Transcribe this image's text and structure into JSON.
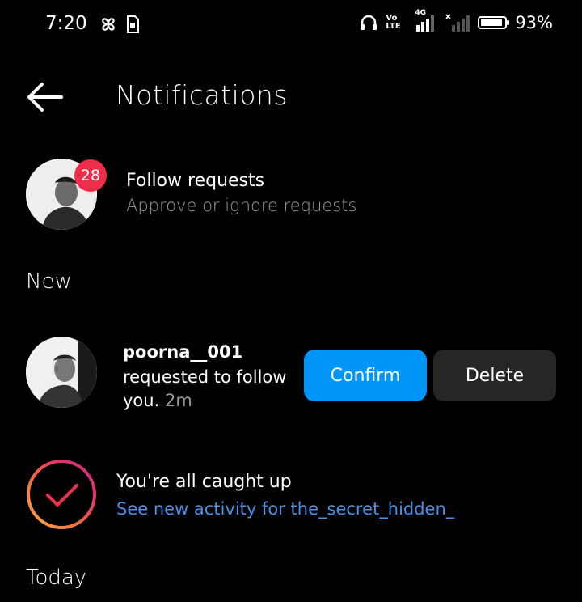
{
  "status_bar": {
    "time": "7:20",
    "volte_label": "Vo LTE",
    "network": "4G",
    "battery_percent": "93%",
    "battery_level": 0.93,
    "icons": [
      "pinwheel-icon",
      "sim-card-icon",
      "headphones-icon",
      "signal-icon",
      "signal-off-icon",
      "battery-icon"
    ]
  },
  "header": {
    "back_icon": "arrow-left-icon",
    "title": "Notifications"
  },
  "follow_requests": {
    "badge_count": "28",
    "title": "Follow requests",
    "subtitle": "Approve or ignore requests"
  },
  "sections": {
    "new": "New",
    "today": "Today"
  },
  "request": {
    "username": "poorna__001",
    "message": "requested to follow you.",
    "time": "2m",
    "confirm_label": "Confirm",
    "delete_label": "Delete"
  },
  "caught_up": {
    "title": "You're all caught up",
    "link": "See new activity for the_secret_hidden_",
    "icon": "check-icon"
  },
  "colors": {
    "accent": "#0095f6",
    "badge": "#ee2e48",
    "link": "#4a90e8",
    "secondary_text": "#9a9a9a",
    "button_dark": "#262626"
  }
}
